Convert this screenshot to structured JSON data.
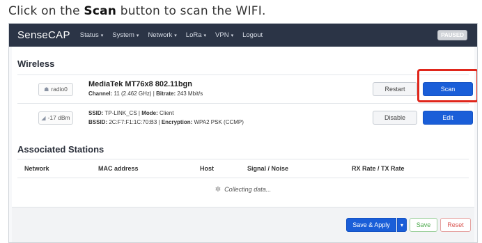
{
  "instruction": {
    "prefix": "Click on the ",
    "emphasis": "Scan",
    "suffix": " button to scan the WIFI."
  },
  "navbar": {
    "brand": "SenseCAP",
    "items": [
      "Status",
      "System",
      "Network",
      "LoRa",
      "VPN",
      "Logout"
    ],
    "paused_badge": "PAUSED"
  },
  "wireless": {
    "title": "Wireless",
    "radio": {
      "badge_label": "radio0",
      "name": "MediaTek MT76x8 802.11bgn",
      "channel_label": "Channel:",
      "channel_value": "11 (2.462 GHz)",
      "bitrate_label": "Bitrate:",
      "bitrate_value": "243 Mbit/s",
      "restart_label": "Restart",
      "scan_label": "Scan"
    },
    "network": {
      "signal_label": "-17 dBm",
      "ssid_label": "SSID:",
      "ssid_value": "TP-LINK_CS",
      "mode_label": "Mode:",
      "mode_value": "Client",
      "bssid_label": "BSSID:",
      "bssid_value": "2C:F7:F1:1C:70:B3",
      "encryption_label": "Encryption:",
      "encryption_value": "WPA2 PSK (CCMP)",
      "disable_label": "Disable",
      "edit_label": "Edit"
    }
  },
  "associated": {
    "title": "Associated Stations",
    "columns": [
      "Network",
      "MAC address",
      "Host",
      "Signal / Noise",
      "RX Rate / TX Rate"
    ],
    "status_text": "Collecting data..."
  },
  "footer": {
    "apply_label": "Save & Apply",
    "save_label": "Save",
    "reset_label": "Reset"
  },
  "colors": {
    "navbar_bg": "#2b3446",
    "primary_button": "#1a5ed8",
    "highlight": "#e0261b"
  }
}
